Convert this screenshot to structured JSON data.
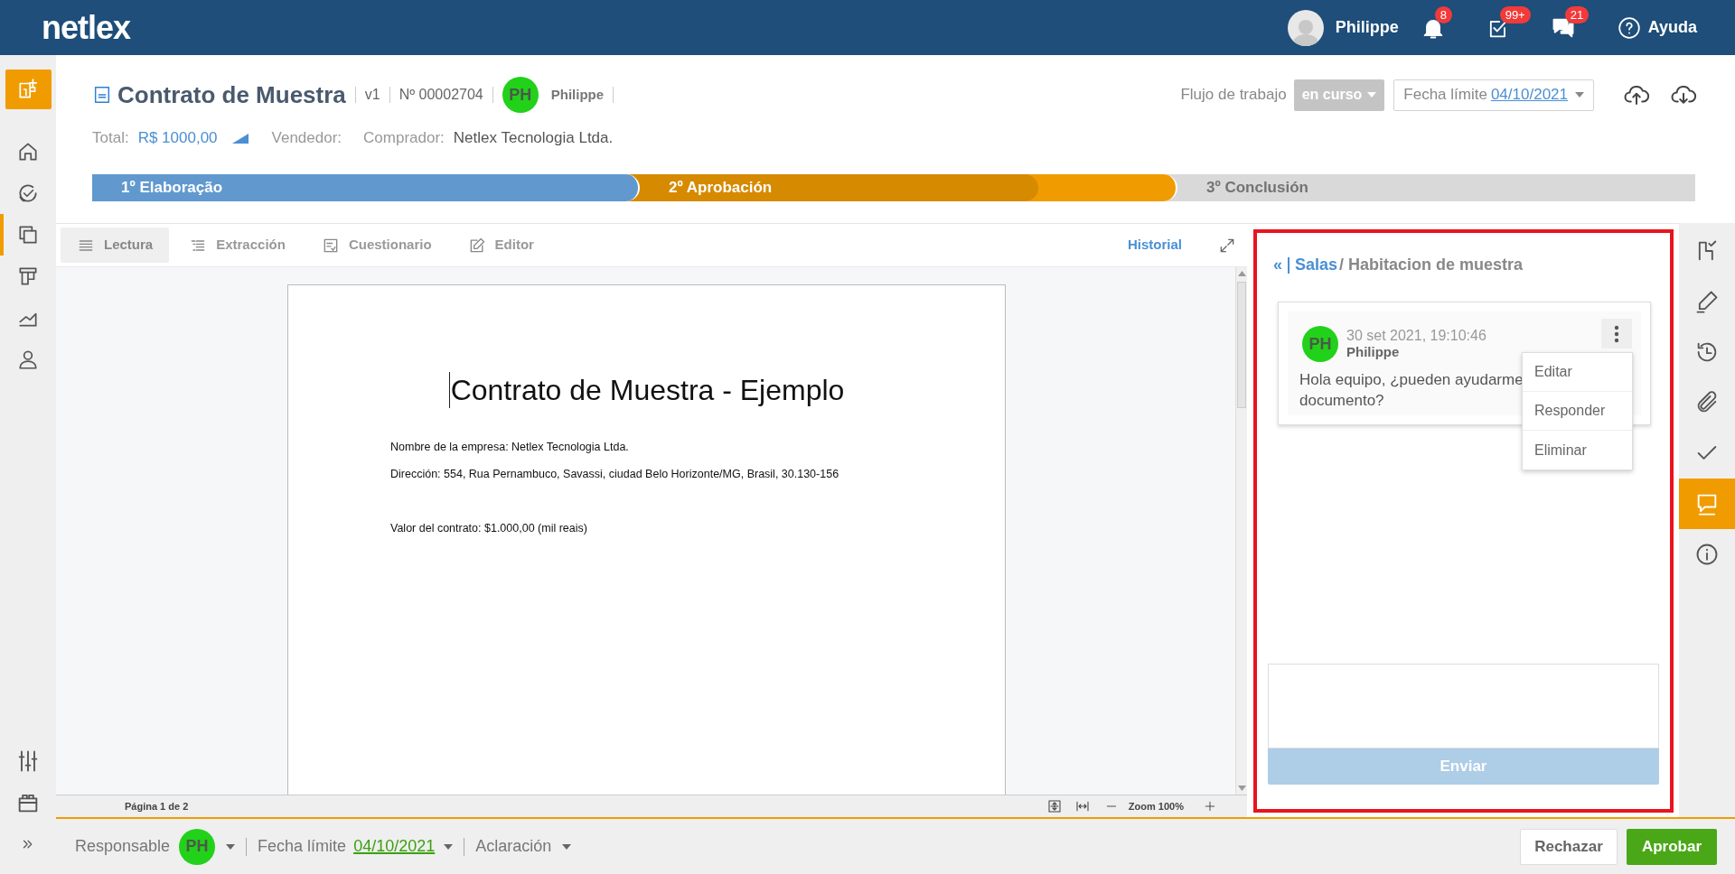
{
  "topbar": {
    "logo": "netlex",
    "user": "Philippe",
    "help": "Ayuda",
    "notifications": [
      {
        "kind": "bell",
        "count": "8"
      },
      {
        "kind": "tasks",
        "count": "99+"
      },
      {
        "kind": "chat",
        "count": "21"
      }
    ]
  },
  "sidebar": {
    "items": [
      {
        "kind": "home",
        "selected": false
      },
      {
        "kind": "dashboard",
        "selected": false
      },
      {
        "kind": "documents",
        "selected": true
      },
      {
        "kind": "templates",
        "selected": false
      },
      {
        "kind": "reports",
        "selected": false
      },
      {
        "kind": "user",
        "selected": false
      }
    ],
    "bottom": [
      {
        "kind": "settings"
      },
      {
        "kind": "calendar"
      },
      {
        "kind": "expand"
      }
    ]
  },
  "document": {
    "title": "Contrato de Muestra",
    "version": "v1",
    "number": "Nº 00002704",
    "owner_initials": "PH",
    "owner": "Philippe",
    "total_label": "Total:",
    "total": "R$ 1000,00",
    "seller_label": "Vendedor:",
    "buyer_label": "Comprador:",
    "buyer": "Netlex Tecnologia Ltda."
  },
  "workflow": {
    "label": "Flujo de trabajo",
    "status": "en curso",
    "deadline_label": "Fecha límite",
    "deadline": "04/10/2021"
  },
  "stages": [
    {
      "label": "1º Elaboração",
      "kind": "done"
    },
    {
      "label": "2º Aprobación",
      "kind": "current",
      "level": 0.75
    },
    {
      "label": "3º Conclusión",
      "kind": "pending"
    }
  ],
  "tabs": [
    {
      "label": "Lectura",
      "kind": "reading",
      "selected": true
    },
    {
      "label": "Extracción",
      "kind": "extraction",
      "selected": false
    },
    {
      "label": "Cuestionario",
      "kind": "form",
      "selected": false
    },
    {
      "label": "Editor",
      "kind": "editor",
      "selected": false
    }
  ],
  "history_link": "Historial",
  "page": {
    "heading": "Contrato de Muestra - Ejemplo",
    "sections": [
      [
        "Nombre de la empresa: Netlex Tecnologia Ltda.",
        "Dirección: 554, Rua Pernambuco, Savassi, ciudad Belo Horizonte/MG, Brasil, 30.130-156"
      ],
      [
        "Valor del contrato: $1.000,00 (mil reais)"
      ]
    ]
  },
  "viewer_status": {
    "page": "Página 1 de 2",
    "zoom": "Zoom 100%"
  },
  "chat": {
    "highlighted": true,
    "back": "«",
    "rooms": "Salas",
    "room": "/ Habitacion de muestra",
    "messages": [
      {
        "initials": "PH",
        "time": "30 set 2021, 19:10:46",
        "author": "Philippe",
        "lines": [
          "Hola equipo, ¿pueden ayudarme",
          "documento?"
        ]
      }
    ],
    "menu": [
      "Editar",
      "Responder",
      "Eliminar"
    ],
    "send_button": "Enviar"
  },
  "rail": [
    {
      "kind": "workflow",
      "selected": false
    },
    {
      "kind": "signature",
      "selected": false
    },
    {
      "kind": "history",
      "selected": false
    },
    {
      "kind": "attachments",
      "selected": false
    },
    {
      "kind": "approvals",
      "selected": false
    },
    {
      "kind": "comments",
      "selected": true
    },
    {
      "kind": "info",
      "selected": false
    }
  ],
  "footer": {
    "responsible_label": "Responsable",
    "initials": "PH",
    "deadline_label": "Fecha límite",
    "deadline": "04/10/2021",
    "clarification": "Aclaración",
    "actions": [
      {
        "label": "Rechazar",
        "kind": "secondary"
      },
      {
        "label": "Aprobar",
        "kind": "primary"
      }
    ]
  }
}
